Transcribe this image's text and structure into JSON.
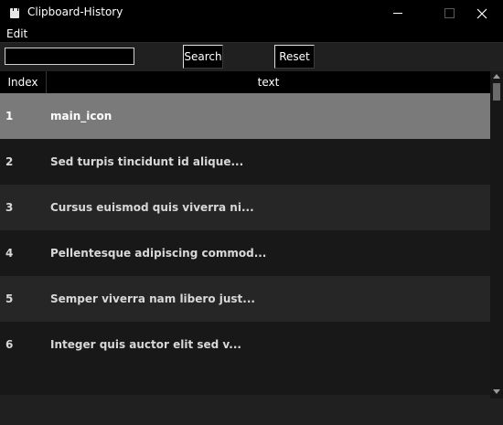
{
  "window": {
    "title": "Clipboard-History",
    "app_icon": "clipboard-icon"
  },
  "menu": {
    "items": [
      "Edit"
    ]
  },
  "toolbar": {
    "search_value": "",
    "search_button_label": "Search",
    "reset_button_label": "Reset"
  },
  "table": {
    "columns": [
      "Index",
      "text"
    ],
    "rows": [
      {
        "index": "1",
        "text": "main_icon"
      },
      {
        "index": "2",
        "text": "Sed turpis tincidunt id alique..."
      },
      {
        "index": "3",
        "text": "Cursus euismod quis viverra ni..."
      },
      {
        "index": "4",
        "text": "Pellentesque adipiscing commod..."
      },
      {
        "index": "5",
        "text": "Semper viverra nam libero just..."
      },
      {
        "index": "6",
        "text": "Integer quis auctor elit sed v..."
      }
    ],
    "selected_row": 0
  },
  "colors": {
    "background": "#202020",
    "titlebar": "#000000",
    "selected_row": "#7a7a7a"
  }
}
